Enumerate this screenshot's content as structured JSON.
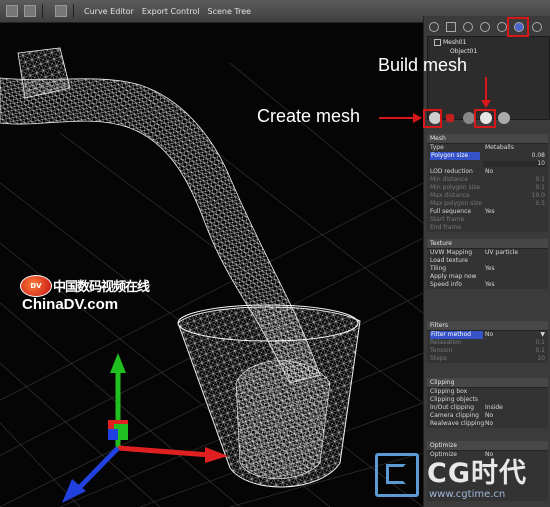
{
  "toolbar": {
    "buttons": [
      "Curve Editor",
      "Export Control",
      "Scene Tree"
    ]
  },
  "annotations": {
    "build_mesh": "Build mesh",
    "create_mesh": "Create mesh",
    "highlight_color": "#d81818"
  },
  "scene_tree": {
    "items": [
      {
        "label": "Mesh01"
      },
      {
        "label": "Object01"
      }
    ]
  },
  "mesh_section": {
    "title": "Mesh",
    "rows": [
      {
        "label": "Type",
        "value": "Metaballs",
        "number": ""
      },
      {
        "label": "Polygon size",
        "value": "",
        "number": "0.08"
      },
      {
        "label": "",
        "value": "",
        "number": "10"
      },
      {
        "label": "LOD reduction",
        "value": "No",
        "number": ""
      },
      {
        "label": "Min distance",
        "value": "",
        "number": "0.1"
      },
      {
        "label": "Min polygon size",
        "value": "",
        "number": "0.1"
      },
      {
        "label": "Max distance",
        "value": "",
        "number": "10.0"
      },
      {
        "label": "Max polygon size",
        "value": "",
        "number": "0.5"
      },
      {
        "label": "Full sequence",
        "value": "Yes",
        "number": ""
      },
      {
        "label": "Start frame",
        "value": "",
        "number": ""
      },
      {
        "label": "End frame",
        "value": "",
        "number": ""
      }
    ]
  },
  "texture_section": {
    "title": "Texture",
    "rows": [
      {
        "label": "UVW Mapping",
        "value": "UV particle"
      },
      {
        "label": "Load texture",
        "value": ""
      },
      {
        "label": "Tiling",
        "value": "Yes"
      },
      {
        "label": "Apply map now",
        "value": ""
      },
      {
        "label": "Speed info",
        "value": "Yes"
      }
    ]
  },
  "filters_section": {
    "title": "Filters",
    "rows": [
      {
        "label": "Filter method",
        "value": "No",
        "number": ""
      },
      {
        "label": "Relaxation",
        "value": "",
        "number": "0.1"
      },
      {
        "label": "Tension",
        "value": "",
        "number": "0.1"
      },
      {
        "label": "Steps",
        "value": "",
        "number": "10"
      }
    ]
  },
  "clipping_section": {
    "title": "Clipping",
    "rows": [
      {
        "label": "Clipping box",
        "value": ""
      },
      {
        "label": "Clipping objects",
        "value": ""
      },
      {
        "label": "In/Out clipping",
        "value": "Inside"
      },
      {
        "label": "Camera clipping",
        "value": "No"
      },
      {
        "label": "Realwave clipping",
        "value": "No"
      }
    ]
  },
  "optimize_section": {
    "title": "Optimize",
    "rows": [
      {
        "label": "Optimize",
        "value": "No"
      }
    ]
  },
  "watermarks": {
    "chinadv_cn": "中国数码视频在线",
    "chinadv_en": "ChinaDV.com",
    "chinadv_mark": "DV",
    "cgtime_title": "CG时代",
    "cgtime_url": "www.cgtime.cn"
  },
  "axis_colors": {
    "x": "#e02020",
    "y": "#20c020",
    "z": "#2040e0"
  }
}
